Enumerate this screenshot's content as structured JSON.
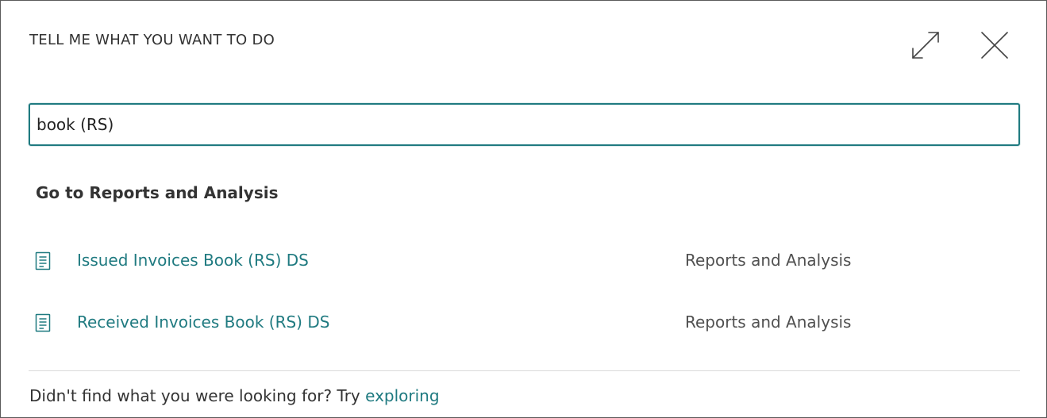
{
  "dialog": {
    "title": "TELL ME WHAT YOU WANT TO DO"
  },
  "search": {
    "value": "book (RS)"
  },
  "results": {
    "section_header": "Go to Reports and Analysis",
    "items": [
      {
        "name": "Issued Invoices Book (RS) DS",
        "category": "Reports and Analysis",
        "icon": "report-icon"
      },
      {
        "name": "Received Invoices Book (RS) DS",
        "category": "Reports and Analysis",
        "icon": "report-icon"
      }
    ]
  },
  "footer": {
    "text": "Didn't find what you were looking for? Try ",
    "link": "exploring"
  },
  "colors": {
    "accent": "#1f7a80",
    "text": "#333333",
    "muted": "#505050"
  }
}
